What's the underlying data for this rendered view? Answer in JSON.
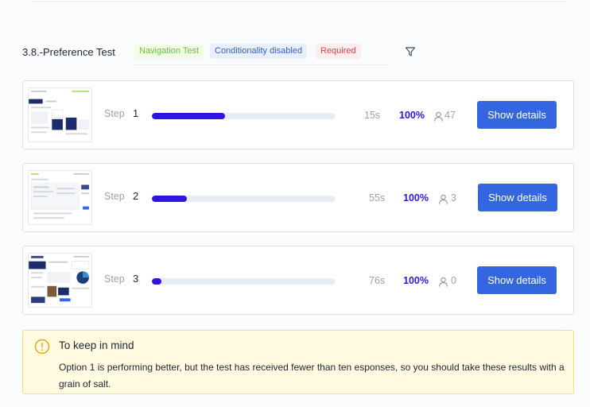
{
  "section": {
    "title": "3.8.-Preference Test",
    "tags": {
      "navigation": "Navigation Test",
      "conditionality": "Conditionality disabled",
      "required": "Required"
    }
  },
  "step_label": "Step",
  "button_label": "Show details",
  "steps": [
    {
      "number": "1",
      "progress": 0.4,
      "time": "15s",
      "percent": "100%",
      "users": "47"
    },
    {
      "number": "2",
      "progress": 0.19,
      "time": "55s",
      "percent": "100%",
      "users": "3"
    },
    {
      "number": "3",
      "progress": 0.05,
      "time": "76s",
      "percent": "100%",
      "users": "0"
    }
  ],
  "note": {
    "title": "To keep in mind",
    "body": "Option 1 is performing better, but the test has received fewer than ten esponses, so you should take these results with a grain of salt."
  },
  "colors": {
    "accent": "#2f15e0",
    "button": "#3366e0",
    "note_bg": "#fffae0",
    "warning": "#e0a800"
  },
  "icons": [
    "filter-icon",
    "user-icon",
    "warning-icon"
  ]
}
